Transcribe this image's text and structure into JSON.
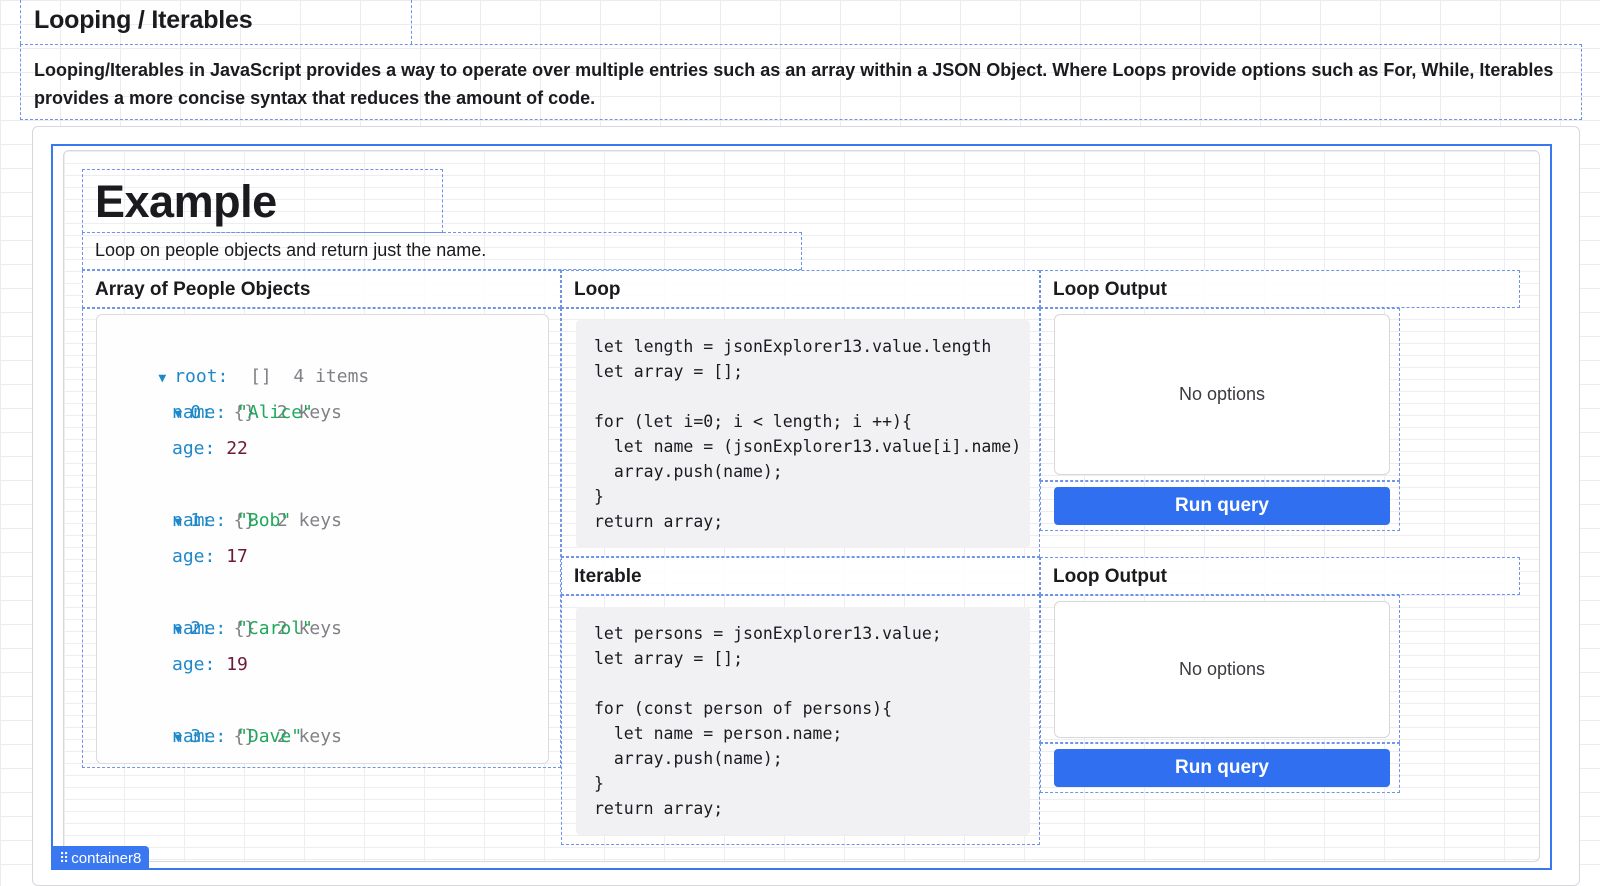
{
  "header": {
    "title": "Looping / Iterables",
    "description": "Looping/Iterables in JavaScript provides a way to operate over multiple entries such as an array within a JSON Object. Where Loops provide options such as For, While, Iterables provides a more concise syntax that reduces the amount of code."
  },
  "example": {
    "title": "Example",
    "subtitle": "Loop on people objects and return just the name."
  },
  "sections": {
    "array_title": "Array of People Objects",
    "loop_title": "Loop",
    "iterable_title": "Iterable",
    "loop_output_title": "Loop Output",
    "iterable_output_title": "Loop Output"
  },
  "json_tree": {
    "root_key": "root:",
    "root_meta": "[]  4 items",
    "items": [
      {
        "key": "0:",
        "meta": "{}  2 keys",
        "name_key": "name:",
        "name": "\"Alice\"",
        "age_key": "age:",
        "age": "22"
      },
      {
        "key": "1:",
        "meta": "{}  2 keys",
        "name_key": "name:",
        "name": "\"Bob\"",
        "age_key": "age:",
        "age": "17"
      },
      {
        "key": "2:",
        "meta": "{}  2 keys",
        "name_key": "name:",
        "name": "\"Carol\"",
        "age_key": "age:",
        "age": "19"
      },
      {
        "key": "3:",
        "meta": "{}  2 keys",
        "name_key": "name:",
        "name": "\"Dave\""
      }
    ]
  },
  "code": {
    "loop": "let length = jsonExplorer13.value.length\nlet array = [];\n\nfor (let i=0; i < length; i ++){\n  let name = (jsonExplorer13.value[i].name)\n  array.push(name);\n}\nreturn array;",
    "iterable": "let persons = jsonExplorer13.value;\nlet array = [];\n\nfor (const person of persons){\n  let name = person.name;\n  array.push(name);\n}\nreturn array;"
  },
  "outputs": {
    "loop_empty": "No options",
    "iterable_empty": "No options",
    "run_label_1": "Run query",
    "run_label_2": "Run query"
  },
  "selection": {
    "container_label": "container8"
  },
  "colors": {
    "accent": "#2f6ff0",
    "selection": "#3a78f2",
    "json_key": "#1e88c8",
    "json_string": "#1fa85a",
    "json_number": "#6a1b3a"
  }
}
